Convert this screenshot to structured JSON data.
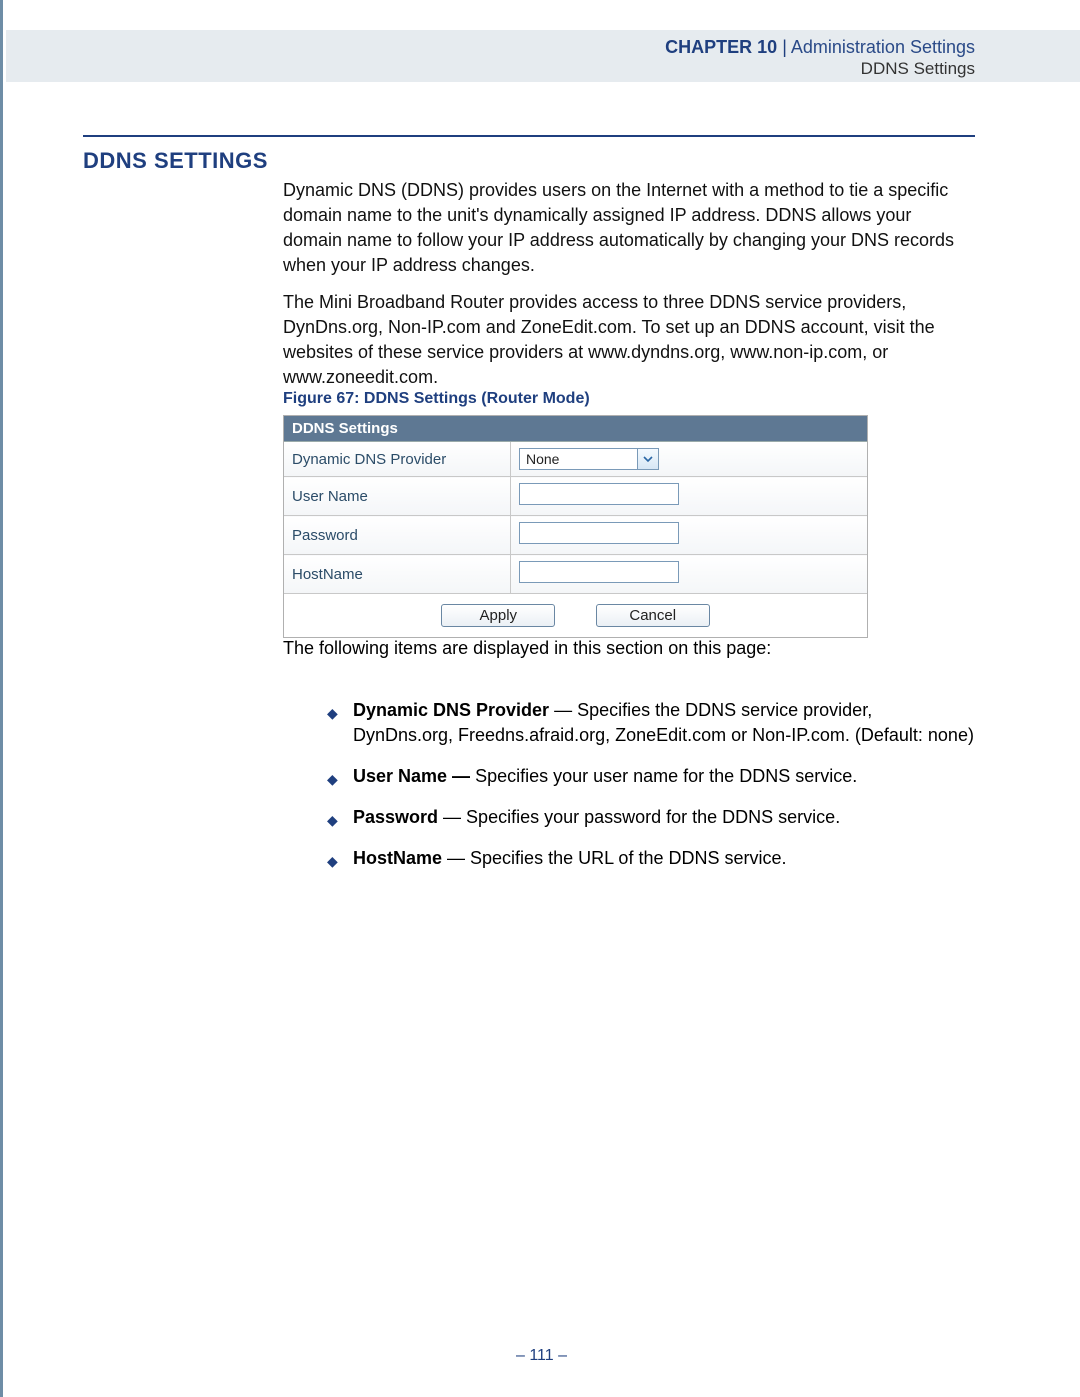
{
  "header": {
    "chapter_label": "CHAPTER 10",
    "separator": "  |  ",
    "section": "Administration Settings",
    "subsection": "DDNS Settings"
  },
  "title": "DDNS SETTINGS",
  "paragraphs": {
    "p1": "Dynamic DNS (DDNS) provides users on the Internet with a method to tie a specific domain name to the unit's dynamically assigned IP address. DDNS allows your domain name to follow your IP address automatically by changing your DNS records when your IP address changes.",
    "p2": "The Mini Broadband Router provides access to three DDNS service providers, DynDns.org, Non-IP.com and ZoneEdit.com. To set up an DDNS account, visit the websites of these service providers at www.dyndns.org, www.non-ip.com, or www.zoneedit.com.",
    "p3": "The following items are displayed in this section on this page:"
  },
  "figure": {
    "caption": "Figure 67:  DDNS Settings (Router Mode)",
    "panel_header": "DDNS Settings",
    "rows": {
      "provider_label": "Dynamic DNS Provider",
      "provider_value": "None",
      "username_label": "User Name",
      "password_label": "Password",
      "hostname_label": "HostName"
    },
    "buttons": {
      "apply": "Apply",
      "cancel": "Cancel"
    }
  },
  "bullets": [
    {
      "name": "Dynamic DNS Provider",
      "desc": " — Specifies the DDNS service provider, DynDns.org, Freedns.afraid.org, ZoneEdit.com or Non-IP.com. (Default: none)"
    },
    {
      "name": "User Name —",
      "desc": " Specifies your user name for the DDNS service."
    },
    {
      "name": "Password",
      "desc": " — Specifies your password for the DDNS service."
    },
    {
      "name": "HostName",
      "desc": " — Specifies the URL of the DDNS service."
    }
  ],
  "page_number": "–  111  –"
}
